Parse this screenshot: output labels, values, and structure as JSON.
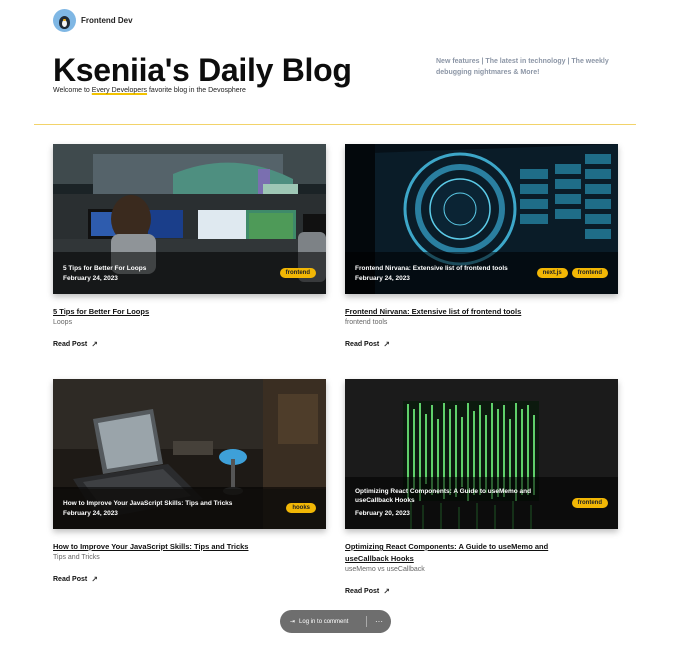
{
  "brand": {
    "name": "Frontend Dev"
  },
  "header": {
    "title": "Kseniia's Daily Blog",
    "welcome_prefix": "Welcome to ",
    "welcome_highlight": "Every Developers",
    "welcome_suffix": " favorite blog in the Devosphere",
    "tagline": "New features | The latest in technology | The weekly debugging nightmares & More!"
  },
  "colors": {
    "accent": "#f2b705",
    "divider": "#f2d36a",
    "tagline": "#8c96a6"
  },
  "posts": [
    {
      "overlay_title": "5 Tips for Better For Loops",
      "date": "February 24, 2023",
      "tags": [
        "frontend"
      ],
      "link_title": "5 Tips for Better For Loops",
      "description": "Loops",
      "read_label": "Read Post"
    },
    {
      "overlay_title": "Frontend Nirvana: Extensive list of frontend tools",
      "date": "February 24, 2023",
      "tags": [
        "next.js",
        "frontend"
      ],
      "link_title": "Frontend Nirvana: Extensive list of frontend tools",
      "description": "frontend tools",
      "read_label": "Read Post"
    },
    {
      "overlay_title": "How to Improve Your JavaScript Skills: Tips and Tricks",
      "date": "February 24, 2023",
      "tags": [
        "hooks"
      ],
      "link_title": "How to Improve Your JavaScript Skills: Tips and Tricks",
      "description": "Tips and Tricks",
      "read_label": "Read Post"
    },
    {
      "overlay_title": "Optimizing React Components: A Guide to useMemo and useCallback Hooks",
      "date": "February 20, 2023",
      "tags": [
        "frontend"
      ],
      "link_title": "Optimizing React Components: A Guide to useMemo and useCallback Hooks",
      "description": "useMemo vs useCallback",
      "read_label": "Read Post"
    }
  ],
  "footer_bar": {
    "login_label": "Log in to comment",
    "more_label": "···"
  }
}
